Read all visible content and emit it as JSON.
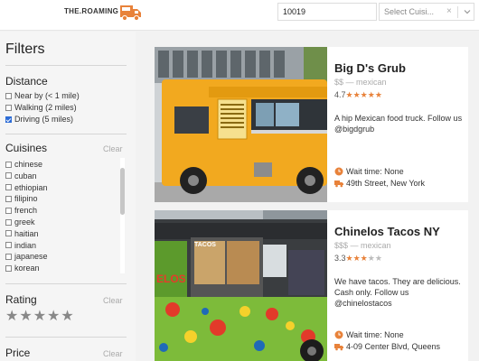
{
  "header": {
    "logo_text": "THE.ROAMING",
    "logo_icon": "food-truck-icon",
    "zip_value": "10019",
    "cuisine_placeholder": "Select Cuisi...",
    "clear_symbol": "×",
    "accent_color": "#e8823a"
  },
  "sidebar": {
    "title": "Filters",
    "distance": {
      "title": "Distance",
      "options": [
        {
          "label": "Near by (< 1 mile)",
          "checked": false
        },
        {
          "label": "Walking (2 miles)",
          "checked": false
        },
        {
          "label": "Driving (5 miles)",
          "checked": true
        }
      ]
    },
    "cuisines": {
      "title": "Cuisines",
      "clear": "Clear",
      "options": [
        "chinese",
        "cuban",
        "ethiopian",
        "filipino",
        "french",
        "greek",
        "haitian",
        "indian",
        "japanese",
        "korean"
      ]
    },
    "rating": {
      "title": "Rating",
      "clear": "Clear",
      "stars": 5
    },
    "price": {
      "title": "Price",
      "clear": "Clear"
    }
  },
  "trucks": [
    {
      "name": "Big D's Grub",
      "price": "$$",
      "cuisine": "mexican",
      "meta": "$$ — mexican",
      "rating": "4.7",
      "rating_value": 4.7,
      "description": "A hip Mexican food truck. Follow us @bigdgrub",
      "wait": "Wait time: None",
      "address": "49th Street, New York"
    },
    {
      "name": "Chinelos Tacos NY",
      "price": "$$$",
      "cuisine": "mexican",
      "meta": "$$$ — mexican",
      "rating": "3.3",
      "rating_value": 3.3,
      "description": "We have tacos. They are delicious. Cash only. Follow us @chinelostacos",
      "wait": "Wait time: None",
      "address": "4-09 Center Blvd, Queens"
    }
  ]
}
